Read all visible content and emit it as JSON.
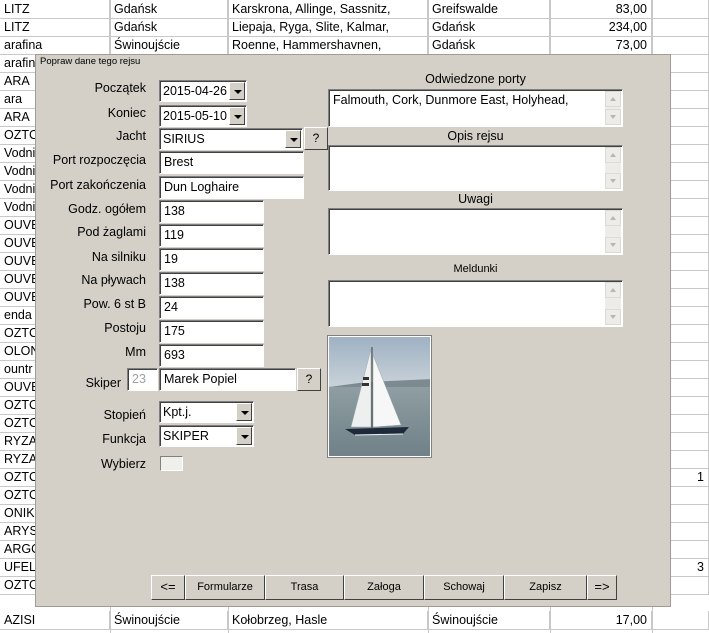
{
  "grid_rows": [
    {
      "c1": "LITZ",
      "c2": "Gdańsk",
      "c3": "Karskrona, Allinge, Sassnitz,",
      "c4": "Greifswalde",
      "c5": "83,00",
      "c6": ""
    },
    {
      "c1": "LITZ",
      "c2": "Gdańsk",
      "c3": "Liepaja, Ryga, Slite, Kalmar,",
      "c4": "Gdańsk",
      "c5": "234,00",
      "c6": ""
    },
    {
      "c1": "arafina",
      "c2": "Świnoujście",
      "c3": "Roenne, Hammershavnen,",
      "c4": "Gdańsk",
      "c5": "73,00",
      "c6": ""
    },
    {
      "c1": "arafin",
      "c2": "",
      "c3": "",
      "c4": "",
      "c5": "",
      "c6": ""
    },
    {
      "c1": "ARA",
      "c2": "",
      "c3": "",
      "c4": "",
      "c5": "",
      "c6": ""
    },
    {
      "c1": "ara",
      "c2": "",
      "c3": "",
      "c4": "",
      "c5": "",
      "c6": ""
    },
    {
      "c1": "ARA",
      "c2": "",
      "c3": "",
      "c4": "",
      "c5": "",
      "c6": ""
    },
    {
      "c1": "OZTC",
      "c2": "",
      "c3": "",
      "c4": "",
      "c5": "",
      "c6": ""
    },
    {
      "c1": "Vodni",
      "c2": "",
      "c3": "",
      "c4": "",
      "c5": "",
      "c6": ""
    },
    {
      "c1": "Vodni",
      "c2": "",
      "c3": "",
      "c4": "",
      "c5": "",
      "c6": ""
    },
    {
      "c1": "Vodni",
      "c2": "",
      "c3": "",
      "c4": "",
      "c5": "",
      "c6": ""
    },
    {
      "c1": "Vodni",
      "c2": "",
      "c3": "",
      "c4": "",
      "c5": "",
      "c6": ""
    },
    {
      "c1": "OUVE",
      "c2": "",
      "c3": "",
      "c4": "",
      "c5": "",
      "c6": ""
    },
    {
      "c1": "OUVE",
      "c2": "",
      "c3": "",
      "c4": "",
      "c5": "",
      "c6": ""
    },
    {
      "c1": "OUVE",
      "c2": "",
      "c3": "",
      "c4": "",
      "c5": "",
      "c6": ""
    },
    {
      "c1": "OUVE",
      "c2": "",
      "c3": "",
      "c4": "",
      "c5": "",
      "c6": ""
    },
    {
      "c1": "OUVE",
      "c2": "",
      "c3": "",
      "c4": "",
      "c5": "",
      "c6": ""
    },
    {
      "c1": "enda",
      "c2": "",
      "c3": "",
      "c4": "",
      "c5": "",
      "c6": ""
    },
    {
      "c1": "OZTC",
      "c2": "",
      "c3": "",
      "c4": "",
      "c5": "",
      "c6": ""
    },
    {
      "c1": "OLON",
      "c2": "",
      "c3": "",
      "c4": "",
      "c5": "",
      "c6": ""
    },
    {
      "c1": "ountr",
      "c2": "",
      "c3": "",
      "c4": "",
      "c5": "",
      "c6": ""
    },
    {
      "c1": "OUVE",
      "c2": "",
      "c3": "",
      "c4": "",
      "c5": "",
      "c6": ""
    },
    {
      "c1": "OZTC",
      "c2": "",
      "c3": "",
      "c4": "",
      "c5": "",
      "c6": ""
    },
    {
      "c1": "OZTC",
      "c2": "",
      "c3": "",
      "c4": "",
      "c5": "",
      "c6": ""
    },
    {
      "c1": "RYZA",
      "c2": "",
      "c3": "",
      "c4": "",
      "c5": "",
      "c6": ""
    },
    {
      "c1": "RYZA",
      "c2": "",
      "c3": "",
      "c4": "",
      "c5": "",
      "c6": ""
    },
    {
      "c1": "OZTC",
      "c2": "",
      "c3": "",
      "c4": "",
      "c5": "",
      "c6": "1"
    },
    {
      "c1": "OZTC",
      "c2": "",
      "c3": "",
      "c4": "",
      "c5": "",
      "c6": ""
    },
    {
      "c1": "ONIK",
      "c2": "",
      "c3": "",
      "c4": "",
      "c5": "",
      "c6": ""
    },
    {
      "c1": "ARYS",
      "c2": "",
      "c3": "",
      "c4": "",
      "c5": "",
      "c6": ""
    },
    {
      "c1": "ARGO",
      "c2": "",
      "c3": "",
      "c4": "",
      "c5": "",
      "c6": ""
    },
    {
      "c1": "UFEL",
      "c2": "",
      "c3": "",
      "c4": "",
      "c5": "",
      "c6": "3"
    },
    {
      "c1": "OZTC",
      "c2": "",
      "c3": "",
      "c4": "",
      "c5": "",
      "c6": ""
    },
    {
      "c1": "AZISI",
      "c2": "Świnoujście",
      "c3": "Kołobrzeg, Hasle",
      "c4": "Świnoujście",
      "c5": "17,00",
      "c6": ""
    }
  ],
  "dialog": {
    "title": "Popraw dane tego rejsu",
    "labels": {
      "start": "Początek",
      "end": "Koniec",
      "yacht": "Jacht",
      "port_start": "Port rozpoczęcia",
      "port_end": "Port zakończenia",
      "hours_total": "Godz. ogółem",
      "under_sail": "Pod żaglami",
      "engine": "Na silniku",
      "sailing": "Na pływach",
      "above6": "Pow. 6 st B",
      "anchored": "Postoju",
      "mm": "Mm",
      "skipper": "Skiper",
      "rank": "Stopień",
      "function": "Funkcja",
      "select": "Wybierz"
    },
    "values": {
      "start": "2015-04-26",
      "end": "2015-05-10",
      "yacht": "SIRIUS",
      "port_start": "Brest",
      "port_end": "Dun Loghaire",
      "hours_total": "138",
      "under_sail": "119",
      "engine": "19",
      "sailing": "138",
      "above6": "24",
      "anchored": "175",
      "mm": "693",
      "skipper_id": "23",
      "skipper_name": "Marek Popiel",
      "rank": "Kpt.j.",
      "function": "SKIPER"
    },
    "q_label": "?",
    "sections": {
      "ports_title": "Odwiedzone porty",
      "ports_text": "Falmouth, Cork, Dunmore East, Holyhead,",
      "desc_title": "Opis rejsu",
      "desc_text": "",
      "notes_title": "Uwagi",
      "notes_text": "",
      "reports_title": "Meldunki",
      "reports_text": ""
    },
    "buttons": {
      "prev": "<=",
      "forms": "Formularze",
      "route": "Trasa",
      "crew": "Załoga",
      "hide": "Schowaj",
      "save": "Zapisz",
      "next": "=>"
    }
  }
}
